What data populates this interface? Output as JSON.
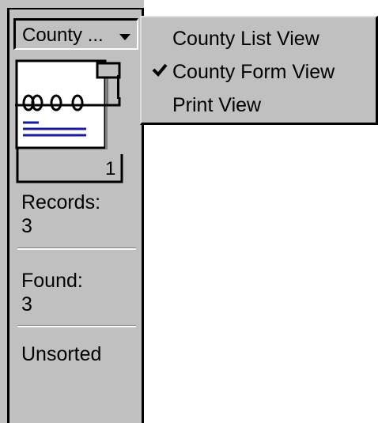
{
  "layout_menu": {
    "current_label": "County ...",
    "items": [
      {
        "label": "County List View",
        "checked": false
      },
      {
        "label": "County Form View",
        "checked": true
      },
      {
        "label": "Print View",
        "checked": false
      }
    ]
  },
  "book": {
    "page_number": "1"
  },
  "status": {
    "records_label": "Records:",
    "records_value": "3",
    "found_label": "Found:",
    "found_value": "3",
    "sort_state": "Unsorted"
  },
  "icons": {
    "popup_arrow": "chevron-down-icon",
    "book": "book-icon",
    "check": "check-icon"
  },
  "colors": {
    "panel": "#c0c0c0",
    "page": "#ffffff",
    "book_lines": "#1a1aa0",
    "frame": "#000000"
  }
}
